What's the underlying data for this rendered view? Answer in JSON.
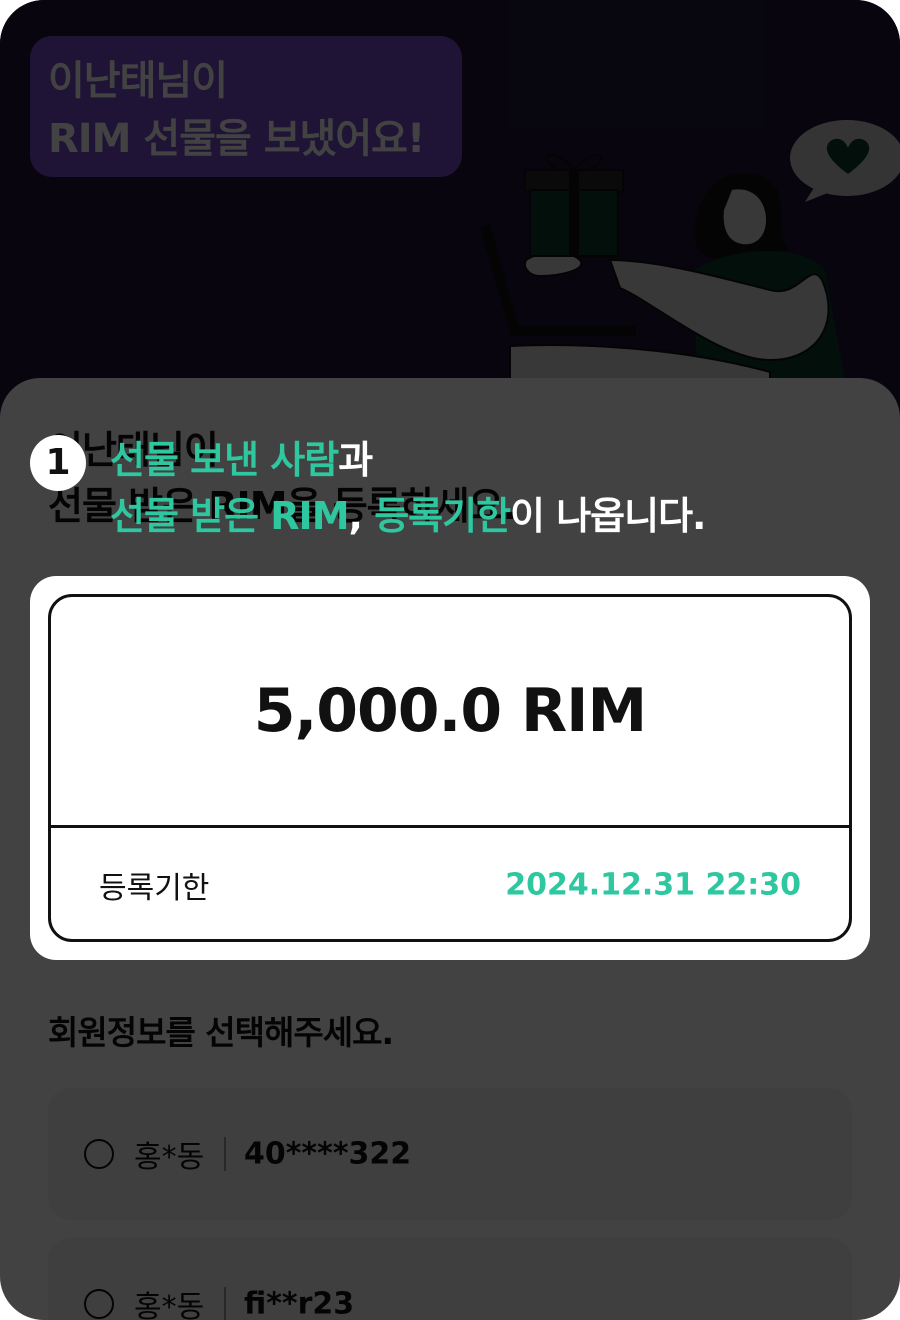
{
  "header": {
    "bubble_line1": "이난태님이",
    "bubble_line2": "RIM 선물을 보냈어요!"
  },
  "sheet": {
    "title_line1": "이난태님이",
    "title_line2": "선물 받은 RIM을 등록하세요."
  },
  "coach": {
    "step": "1",
    "line1_highlight": "선물 보낸 사람",
    "line1_rest": "과",
    "line2_highlight_a": "선물 받은 RIM",
    "line2_comma": ", ",
    "line2_highlight_b": "등록기한",
    "line2_rest": "이 나옵니다."
  },
  "gift_card": {
    "amount": "5,000.0 RIM",
    "deadline_label": "등록기한",
    "deadline_value": "2024.12.31 22:30"
  },
  "members": {
    "heading": "회원정보를 선택해주세요.",
    "options": [
      {
        "name": "홍*동",
        "id": "40****322"
      },
      {
        "name": "홍*동",
        "id": "fi**r23"
      }
    ]
  },
  "colors": {
    "header_bg": "#1f1637",
    "bubble_bg": "#7d4fd0",
    "accent_green": "#2ec7a0",
    "illustration_green": "#0d3a2c"
  },
  "icons": [
    "gift-icon",
    "heart-speech-bubble-icon",
    "radio-icon"
  ]
}
